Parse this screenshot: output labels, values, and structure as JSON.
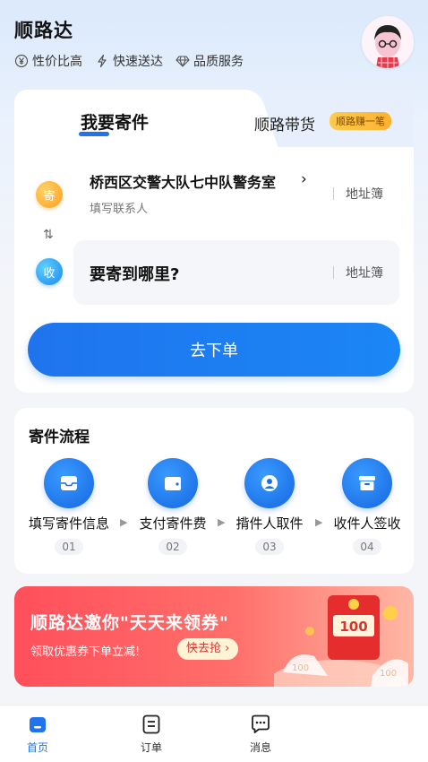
{
  "header": {
    "app_title": "顺路达",
    "features": [
      {
        "icon": "yen-icon",
        "label": "性价比高"
      },
      {
        "icon": "lightning-icon",
        "label": "快速送达"
      },
      {
        "icon": "diamond-icon",
        "label": "品质服务"
      }
    ]
  },
  "tabs": {
    "active": "我要寄件",
    "other": "顺路带货",
    "badge": "顺路赚一笔"
  },
  "sender": {
    "badge": "寄",
    "address": "桥西区交警大队七中队警务室",
    "sub": "填写联系人",
    "address_book": "地址簿"
  },
  "swap_icon": "⇅",
  "receiver": {
    "badge": "收",
    "question": "要寄到哪里?",
    "address_book": "地址簿"
  },
  "order_button": "去下单",
  "flow": {
    "title": "寄件流程",
    "steps": [
      {
        "label": "填写寄件信息",
        "num": "01",
        "icon": "form-icon"
      },
      {
        "label": "支付寄件费",
        "num": "02",
        "icon": "wallet-icon"
      },
      {
        "label": "揹件人取件",
        "num": "03",
        "icon": "person-icon"
      },
      {
        "label": "收件人签收",
        "num": "04",
        "icon": "box-icon"
      }
    ]
  },
  "banner": {
    "title": "顺路达邀你\"天天来领券\"",
    "sub": "领取优惠券下单立减!",
    "cta": "快去抢 ›",
    "coupon_value": "100"
  },
  "tabbar": [
    {
      "label": "首页",
      "active": true,
      "icon": "home-icon"
    },
    {
      "label": "订单",
      "active": false,
      "icon": "order-icon"
    },
    {
      "label": "消息",
      "active": false,
      "icon": "message-icon"
    }
  ],
  "colors": {
    "primary": "#1f74ee",
    "ship_badge": "#ff9d1a",
    "banner": "#ff4f5b"
  }
}
